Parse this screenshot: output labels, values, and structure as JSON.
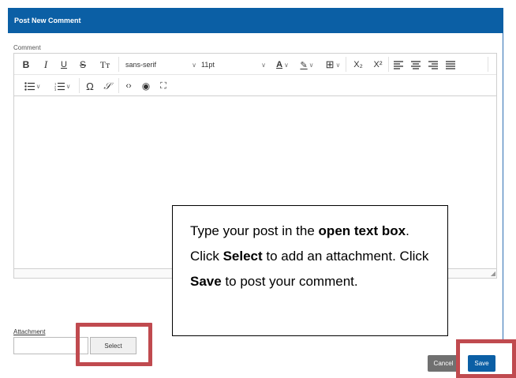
{
  "dialog": {
    "title": "Post New Comment"
  },
  "comment": {
    "label": "Comment"
  },
  "toolbar": {
    "bold": "B",
    "italic": "I",
    "underline": "U",
    "strikethrough": "S",
    "font_size_icon": "Tт",
    "font_family": "sans-serif",
    "font_size": "11pt",
    "text_color": "A",
    "highlight": "✎",
    "table": "⊞",
    "subscript": "X₂",
    "superscript": "X²",
    "bullet_list": "☰",
    "numbered_list": "☰",
    "special_char": "Ω",
    "link": "𝒮",
    "source_code": "‹›",
    "preview": "◉",
    "fullscreen": "⛶"
  },
  "callout": {
    "parts": [
      "Type your post in the ",
      "open text box",
      ". Click ",
      "Select",
      " to add an attachment. Click ",
      "Save",
      " to post your comment."
    ]
  },
  "attachment": {
    "label": "Attachment",
    "select_label": "Select"
  },
  "actions": {
    "cancel_label": "Cancel",
    "save_label": "Save"
  },
  "colors": {
    "header": "#0b5fa5",
    "highlight_box": "#c04a4f",
    "cancel": "#707070"
  }
}
